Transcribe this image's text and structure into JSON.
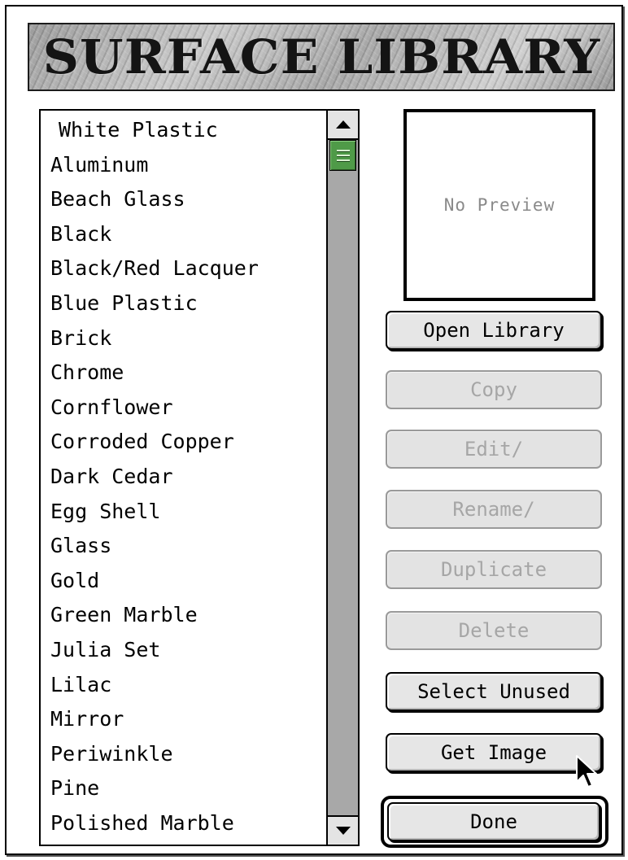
{
  "dialog": {
    "title": "SURFACE LIBRARY"
  },
  "surfaces": {
    "items": [
      "White Plastic",
      "Aluminum",
      "Beach Glass",
      "Black",
      "Black/Red Lacquer",
      "Blue Plastic",
      "Brick",
      "Chrome",
      "Cornflower",
      "Corroded Copper",
      "Dark Cedar",
      "Egg Shell",
      "Glass",
      "Gold",
      "Green Marble",
      "Julia Set",
      "Lilac",
      "Mirror",
      "Periwinkle",
      "Pine",
      "Polished Marble"
    ]
  },
  "preview": {
    "text": "No Preview"
  },
  "buttons": {
    "open_library": "Open Library",
    "copy": "Copy",
    "edit": "Edit/",
    "rename": "Rename/",
    "duplicate": "Duplicate",
    "delete": "Delete",
    "select_unused": "Select Unused",
    "get_image": "Get Image",
    "done": "Done"
  },
  "states": {
    "copy_enabled": false,
    "edit_enabled": false,
    "rename_enabled": false,
    "duplicate_enabled": false,
    "delete_enabled": false
  },
  "icons": {
    "scroll_up": "up-arrow-icon",
    "scroll_down": "down-arrow-icon",
    "scroll_thumb": "scroll-thumb-grip-icon",
    "pointer": "mouse-pointer-icon"
  },
  "colors": {
    "scroll_thumb": "#4f9a48",
    "disabled_text": "#a6a6a6",
    "preview_text": "#8a8a8a"
  }
}
